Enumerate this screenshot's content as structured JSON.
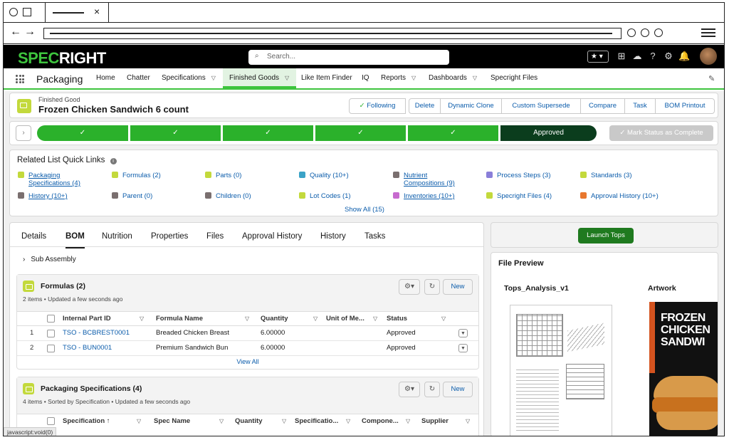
{
  "header": {
    "logo_main": "SPEC",
    "logo_accent": "RIGHT",
    "search_placeholder": "Search..."
  },
  "nav": {
    "app_name": "Packaging",
    "items": [
      {
        "label": "Home"
      },
      {
        "label": "Chatter"
      },
      {
        "label": "Specifications"
      },
      {
        "label": "Finished Goods"
      },
      {
        "label": "Like Item Finder"
      },
      {
        "label": "IQ"
      },
      {
        "label": "Reports"
      },
      {
        "label": "Dashboards"
      },
      {
        "label": "Specright Files"
      }
    ]
  },
  "record": {
    "type": "Finished Good",
    "name": "Frozen Chicken Sandwich 6 count",
    "actions": [
      "Following",
      "Delete",
      "Dynamic Clone",
      "Custom Supersede",
      "Compare",
      "Task",
      "BOM Printout"
    ]
  },
  "path": {
    "steps": [
      "✓",
      "✓",
      "✓",
      "✓",
      "✓",
      "Approved"
    ],
    "mark_label": "Mark Status as Complete"
  },
  "quicklinks": {
    "title": "Related List Quick Links",
    "row1": [
      {
        "label": "Packaging Specifications (4)",
        "color": "#c3d93c"
      },
      {
        "label": "Formulas (2)",
        "color": "#c3d93c"
      },
      {
        "label": "Parts (0)",
        "color": "#c3d93c"
      },
      {
        "label": "Quality (10+)",
        "color": "#3ba3c7"
      },
      {
        "label": "Nutrient Compositions (9)",
        "color": "#7a6f6f"
      },
      {
        "label": "Process Steps (3)",
        "color": "#8a7fd9"
      },
      {
        "label": "Standards (3)",
        "color": "#c3d93c"
      }
    ],
    "row2": [
      {
        "label": "History (10+)",
        "color": "#7a6f6f"
      },
      {
        "label": "Parent (0)",
        "color": "#7a6f6f"
      },
      {
        "label": "Children (0)",
        "color": "#7a6f6f"
      },
      {
        "label": "Lot Codes (1)",
        "color": "#c3d93c"
      },
      {
        "label": "Inventories (10+)",
        "color": "#c76bcf"
      },
      {
        "label": "Specright Files (4)",
        "color": "#c3d93c"
      },
      {
        "label": "Approval History (10+)",
        "color": "#e8772e"
      }
    ],
    "show_all": "Show All (15)"
  },
  "tabs": [
    "Details",
    "BOM",
    "Nutrition",
    "Properties",
    "Files",
    "Approval History",
    "History",
    "Tasks"
  ],
  "sub_assembly": "Sub Assembly",
  "formulas": {
    "title": "Formulas (2)",
    "meta": "2 items • Updated a few seconds ago",
    "new_label": "New",
    "columns": [
      "Internal Part ID",
      "Formula Name",
      "Quantity",
      "Unit of Me...",
      "Status"
    ],
    "rows": [
      {
        "num": "1",
        "id": "TSO - BCBREST0001",
        "name": "Breaded Chicken Breast",
        "qty": "6.00000",
        "status": "Approved"
      },
      {
        "num": "2",
        "id": "TSO - BUN0001",
        "name": "Premium Sandwich Bun",
        "qty": "6.00000",
        "status": "Approved"
      }
    ],
    "view_all": "View All"
  },
  "packaging": {
    "title": "Packaging Specifications (4)",
    "meta": "4 items • Sorted by Specification • Updated a few seconds ago",
    "new_label": "New",
    "columns": [
      "Specification ↑",
      "Spec Name",
      "Quantity",
      "Specificatio...",
      "Compone...",
      "Supplier"
    ]
  },
  "right": {
    "launch_label": "Launch Tops",
    "preview_title": "File Preview",
    "file1": "Tops_Analysis_v1",
    "file2": "Artwork",
    "artwork_text": "FROZEN CHICKEN SANDWI"
  },
  "statusbar": "javascript:void(0)"
}
